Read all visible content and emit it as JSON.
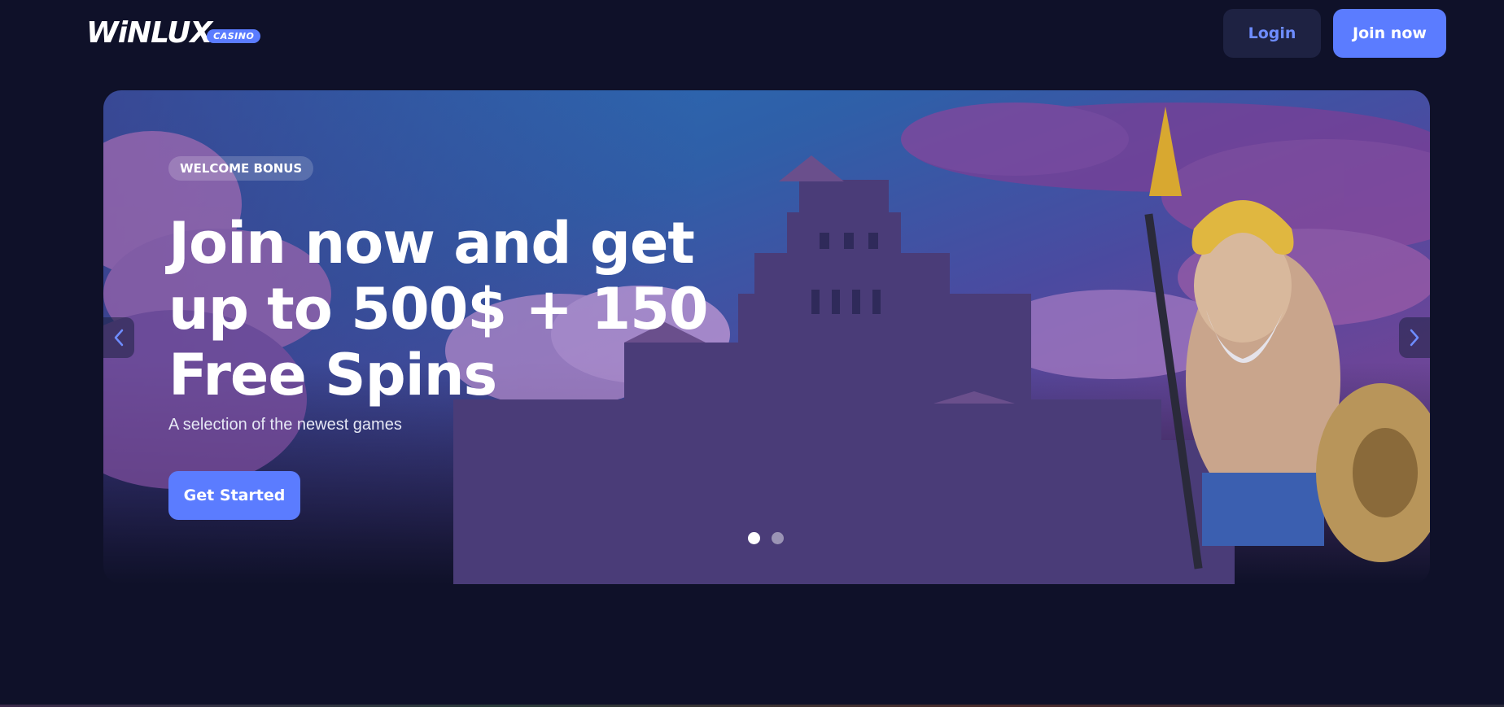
{
  "header": {
    "logo_text": "WiNLUX",
    "logo_badge": "CASINO",
    "login_label": "Login",
    "join_label": "Join now"
  },
  "hero": {
    "badge": "WELCOME BONUS",
    "headline_line1": "Join now and get",
    "headline_line2": "up to 500$ + 150",
    "headline_line3": "Free Spins",
    "subtext": "A selection of the newest games",
    "cta_label": "Get Started",
    "slides_total": 2,
    "active_slide": 1
  },
  "colors": {
    "background": "#0f1129",
    "accent": "#5b7cff",
    "login_bg": "#1e2242",
    "login_text": "#6e8dff"
  },
  "icons": {
    "prev": "chevron-left-icon",
    "next": "chevron-right-icon"
  }
}
